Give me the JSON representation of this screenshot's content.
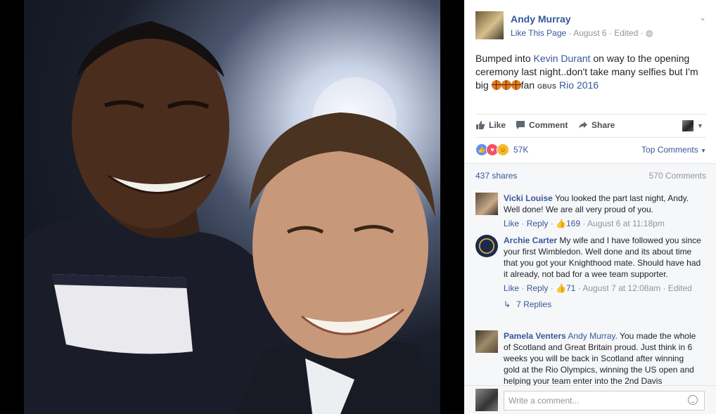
{
  "post": {
    "author": "Andy Murray",
    "like_page": "Like This Page",
    "date": "August 6",
    "edited": "Edited",
    "text_1": "Bumped into ",
    "mention": "Kevin Durant",
    "text_2": " on way to the opening ceremony last night..don't take many selfies but I'm big ",
    "text_3": "fan ",
    "tag_small": "GBUS",
    "hashtag": "Rio 2016"
  },
  "actions": {
    "like": "Like",
    "comment": "Comment",
    "share": "Share"
  },
  "reactions": {
    "count": "57K",
    "top_comments": "Top Comments"
  },
  "stats": {
    "shares": "437 shares",
    "comments": "570 Comments"
  },
  "comments": [
    {
      "name": "Vicki Louise",
      "text": "You looked the part last night, Andy. Well done! We are all very proud of you.",
      "like": "Like",
      "reply": "Reply",
      "likes": "169",
      "time": "August 6 at 11:18pm"
    },
    {
      "name": "Archie Carter",
      "text": "My wife and I have followed you since your first Wimbledon. Well done and its about time that you got your Knighthood mate. Should have had it already, not bad for a wee team supporter.",
      "like": "Like",
      "reply": "Reply",
      "likes": "71",
      "time": "August 7 at 12:08am",
      "edited": "Edited",
      "replies": "7 Replies"
    },
    {
      "name": "Pamela Venters",
      "mention": "Andy Murray",
      "text": ". You made the whole of Scotland and Great Britain proud. Just think in 6 weeks you will be back in Scotland after winning gold at the Rio Olympics, winning the US open and helping your team enter into the 2nd Davis"
    }
  ],
  "write_comment": {
    "placeholder": "Write a comment..."
  }
}
